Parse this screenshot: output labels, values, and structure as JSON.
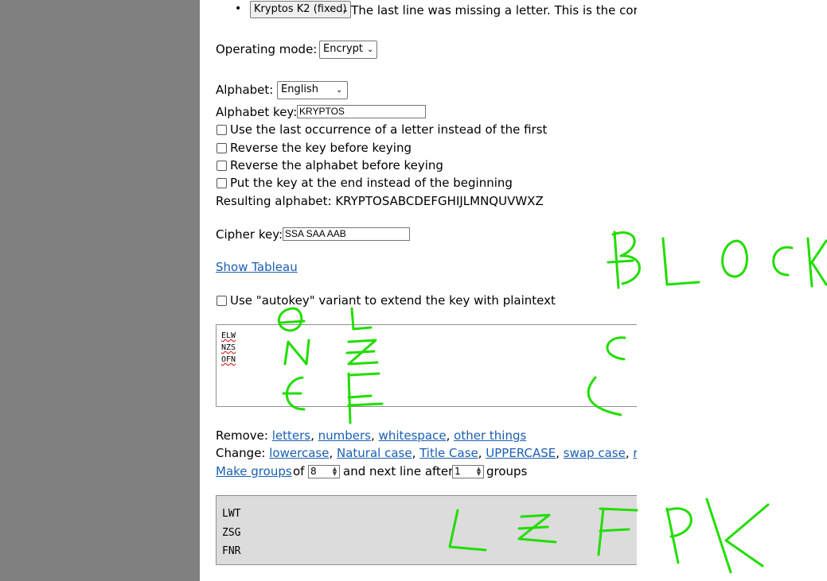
{
  "preset": {
    "button": "Kryptos K2 (fixed)",
    "desc": " - The last line was missing a letter. This is the correct"
  },
  "mode": {
    "label": "Operating mode:",
    "value": "Encrypt"
  },
  "alphabet": {
    "label": "Alphabet:",
    "value": "English"
  },
  "alphabet_key": {
    "label": "Alphabet key:",
    "value": "KRYPTOS"
  },
  "options": [
    "Use the last occurrence of a letter instead of the first",
    "Reverse the key before keying",
    "Reverse the alphabet before keying",
    "Put the key at the end instead of the beginning"
  ],
  "resulting": "Resulting alphabet: KRYPTOSABCDEFGHIJLMNQUVWXZ",
  "cipher_key": {
    "label": "Cipher key:",
    "value": "SSA SAA AAB"
  },
  "show_tableau": "Show Tableau",
  "autokey": "Use \"autokey\" variant to extend the key with plaintext",
  "input_lines": [
    "ELW",
    "NZS",
    "OFN"
  ],
  "remove": {
    "label": "Remove:",
    "items": [
      "letters",
      "numbers",
      "whitespace",
      "other things"
    ]
  },
  "change": {
    "label": "Change:",
    "items": [
      "lowercase",
      "Natural case",
      "Title Case",
      "UPPERCASE",
      "swap case",
      "reverse"
    ]
  },
  "groups": {
    "link": "Make groups",
    "of": "of",
    "size": "8",
    "mid": "and next line after",
    "lines": "1",
    "tail": "groups"
  },
  "output_lines": [
    "LWT",
    "ZSG",
    "FNR"
  ],
  "annotation": {
    "word": "BLOCK",
    "color": "#22dd00"
  }
}
